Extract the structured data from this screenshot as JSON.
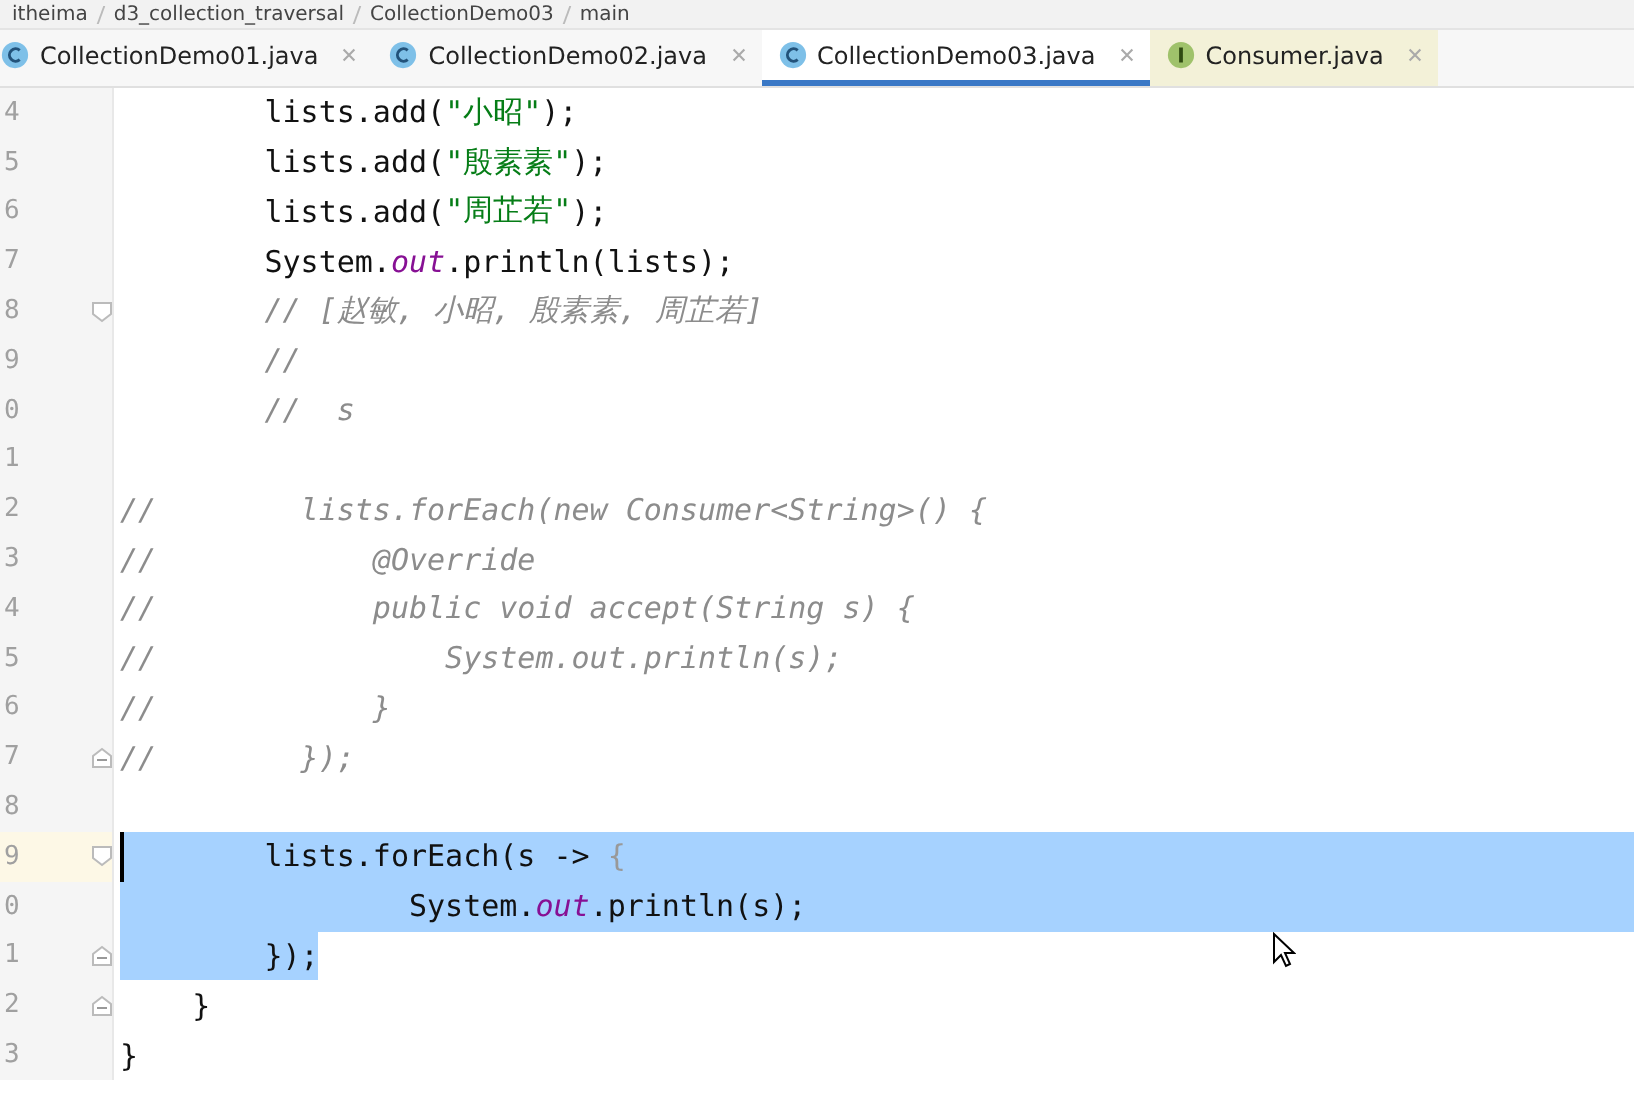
{
  "breadcrumb": [
    "itheima",
    "d3_collection_traversal",
    "CollectionDemo03",
    "main"
  ],
  "tabs": [
    {
      "label": "CollectionDemo01.java",
      "kind": "class",
      "selected": false
    },
    {
      "label": "CollectionDemo02.java",
      "kind": "class",
      "selected": false
    },
    {
      "label": "CollectionDemo03.java",
      "kind": "class",
      "selected": true
    },
    {
      "label": "Consumer.java",
      "kind": "interface",
      "selected": false
    }
  ],
  "lines": [
    {
      "number": "4",
      "segments": [
        {
          "kind": "plain",
          "text": "        lists.add("
        },
        {
          "kind": "string",
          "text": "\"小昭\""
        },
        {
          "kind": "plain",
          "text": ");"
        }
      ]
    },
    {
      "number": "5",
      "segments": [
        {
          "kind": "plain",
          "text": "        lists.add("
        },
        {
          "kind": "string",
          "text": "\"殷素素\""
        },
        {
          "kind": "plain",
          "text": ");"
        }
      ]
    },
    {
      "number": "6",
      "segments": [
        {
          "kind": "plain",
          "text": "        lists.add("
        },
        {
          "kind": "string",
          "text": "\"周芷若\""
        },
        {
          "kind": "plain",
          "text": ");"
        }
      ]
    },
    {
      "number": "7",
      "segments": [
        {
          "kind": "plain",
          "text": "        System."
        },
        {
          "kind": "field",
          "text": "out"
        },
        {
          "kind": "plain",
          "text": ".println(lists);"
        }
      ]
    },
    {
      "number": "8",
      "fold_start": true,
      "segments": [
        {
          "kind": "comment",
          "text": "        // [赵敏, 小昭, 殷素素, 周芷若]"
        }
      ]
    },
    {
      "number": "9",
      "segments": [
        {
          "kind": "comment",
          "text": "        //"
        }
      ]
    },
    {
      "number": "0",
      "segments": [
        {
          "kind": "comment",
          "text": "        //  s"
        }
      ]
    },
    {
      "number": "1"
    },
    {
      "number": "2",
      "segments": [
        {
          "kind": "comment",
          "text": "//        lists.forEach(new Consumer<String>() {"
        }
      ]
    },
    {
      "number": "3",
      "segments": [
        {
          "kind": "comment",
          "text": "//            @Override"
        }
      ]
    },
    {
      "number": "4",
      "segments": [
        {
          "kind": "comment",
          "text": "//            public void accept(String s) {"
        }
      ]
    },
    {
      "number": "5",
      "segments": [
        {
          "kind": "comment",
          "text": "//                System.out.println(s);"
        }
      ]
    },
    {
      "number": "6",
      "segments": [
        {
          "kind": "comment",
          "text": "//            }"
        }
      ]
    },
    {
      "number": "7",
      "fold_end": true,
      "segments": [
        {
          "kind": "comment",
          "text": "//        });"
        }
      ]
    },
    {
      "number": "8"
    },
    {
      "number": "9",
      "current": true,
      "fold_start": true,
      "selected_to_end": true,
      "caret": true,
      "segments": [
        {
          "kind": "plain",
          "text": "        lists.forEach(s -> ",
          "selected": true
        },
        {
          "kind": "muted",
          "text": "{",
          "selected": true
        }
      ]
    },
    {
      "number": "0",
      "selected_to_end": true,
      "segments": [
        {
          "kind": "plain",
          "text": "                System.",
          "selected": true
        },
        {
          "kind": "field",
          "text": "out",
          "selected": true
        },
        {
          "kind": "plain",
          "text": ".println(s);",
          "selected": true
        }
      ]
    },
    {
      "number": "1",
      "fold_end": true,
      "segments": [
        {
          "kind": "plain",
          "text": "        });",
          "selected": true
        }
      ]
    },
    {
      "number": "2",
      "fold_end": true,
      "segments": [
        {
          "kind": "plain",
          "text": "    }"
        }
      ]
    },
    {
      "number": "3",
      "segments": [
        {
          "kind": "plain",
          "text": "}"
        }
      ]
    }
  ]
}
